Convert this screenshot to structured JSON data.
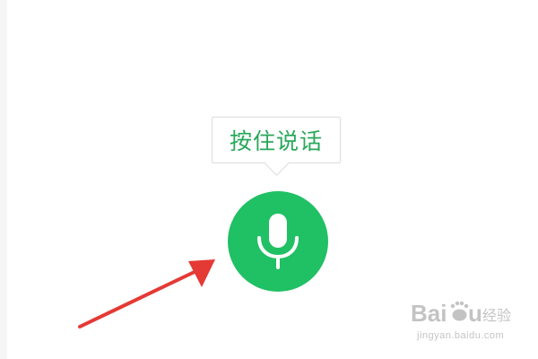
{
  "voice_input": {
    "tooltip_text": "按住说话",
    "mic_icon": "microphone-icon",
    "accent_color": "#20c064",
    "tooltip_text_color": "#2aa85b"
  },
  "annotation": {
    "arrow_color": "#e53935",
    "arrow_icon": "red-arrow-icon"
  },
  "watermark": {
    "brand_logo": "Baidu经验",
    "url": "jingyan.baidu.com"
  }
}
